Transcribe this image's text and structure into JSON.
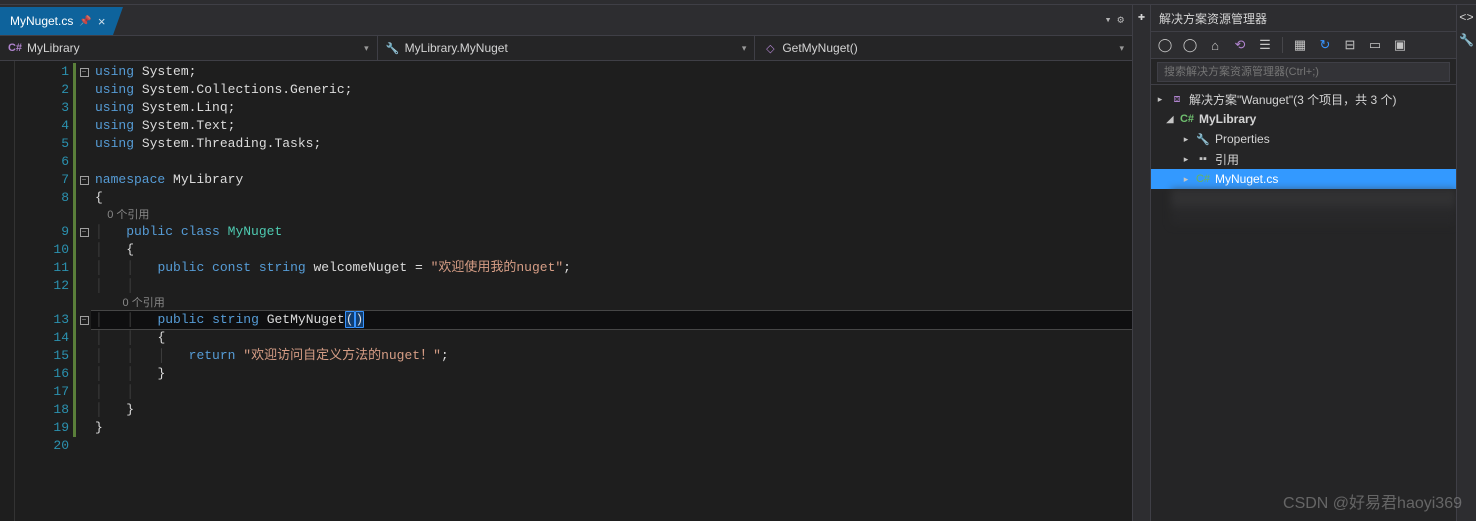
{
  "tab": {
    "filename": "MyNuget.cs"
  },
  "breadcrumb": {
    "project": "MyLibrary",
    "class": "MyLibrary.MyNuget",
    "method": "GetMyNuget()"
  },
  "code": {
    "lines": [
      "1",
      "2",
      "3",
      "4",
      "5",
      "6",
      "7",
      "8",
      "9",
      "10",
      "11",
      "12",
      "13",
      "14",
      "15",
      "16",
      "17",
      "18",
      "19",
      "20"
    ],
    "usings": [
      [
        "using",
        "System",
        "."
      ],
      [
        "using",
        "System",
        ".",
        "Collections",
        ".",
        "Generic",
        "."
      ],
      [
        "using",
        "System",
        ".",
        "Linq",
        "."
      ],
      [
        "using",
        "System",
        ".",
        "Text",
        "."
      ],
      [
        "using",
        "System",
        ".",
        "Threading",
        ".",
        "Tasks",
        "."
      ]
    ],
    "namespace_kw": "namespace",
    "namespace_name": "MyLibrary",
    "ref_hint": "0 个引用",
    "class_decl": {
      "mods": "public class",
      "name": "MyNuget"
    },
    "const_decl": {
      "mods": "public const",
      "type": "string",
      "name": "welcomeNuget",
      "value": "\"欢迎使用我的nuget\""
    },
    "method_decl": {
      "mods": "public",
      "type": "string",
      "name": "GetMyNuget"
    },
    "return_kw": "return",
    "return_value": "\"欢迎访问自定义方法的nuget！\""
  },
  "solution_explorer": {
    "title": "解决方案资源管理器",
    "search_placeholder": "搜索解决方案资源管理器(Ctrl+;)",
    "solution_label": "解决方案\"Wanuget\"(3 个项目，共 3 个)",
    "project": "MyLibrary",
    "properties": "Properties",
    "references": "引用",
    "file": "MyNuget.cs"
  },
  "watermark": "CSDN @好易君haoyi369"
}
